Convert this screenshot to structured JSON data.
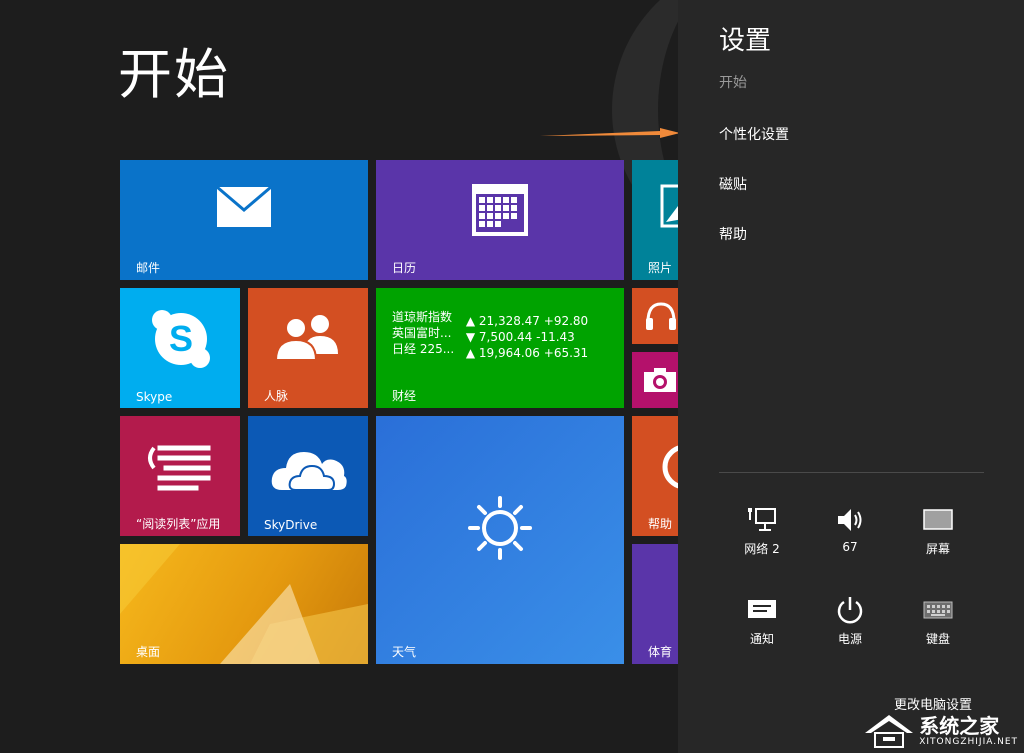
{
  "start": {
    "title": "开始",
    "tiles": {
      "mail": "邮件",
      "calendar": "日历",
      "photos": "照片",
      "skype": "Skype",
      "people": "人脉",
      "finance": "财经",
      "reading_list": "“阅读列表”应用",
      "skydrive": "SkyDrive",
      "weather": "天气",
      "help": "帮助",
      "desktop": "桌面",
      "sports": "体育"
    },
    "finance_rows": [
      {
        "name": "道琼斯指数",
        "value": "▲ 21,328.47 +92.80"
      },
      {
        "name": "英国富时...",
        "value": "▼ 7,500.44 -11.43"
      },
      {
        "name": "日经 225...",
        "value": "▲ 19,964.06 +65.31"
      }
    ]
  },
  "settings": {
    "title": "设置",
    "subtitle": "开始",
    "items": [
      "个性化设置",
      "磁贴",
      "帮助"
    ],
    "quick": [
      {
        "label": "网络 2",
        "icon": "network-icon"
      },
      {
        "label": "67",
        "icon": "volume-icon"
      },
      {
        "label": "屏幕",
        "icon": "screen-icon"
      },
      {
        "label": "通知",
        "icon": "notification-icon"
      },
      {
        "label": "电源",
        "icon": "power-icon"
      },
      {
        "label": "键盘",
        "icon": "keyboard-icon"
      }
    ],
    "change_pc": "更改电脑设置"
  },
  "watermark": {
    "text": "系统之家",
    "url": "XITONGZHIJIA.NET"
  },
  "colors": {
    "accent_arrow": "#f08a3a",
    "panel_bg": "#272727",
    "start_bg": "#1d1d1d"
  }
}
